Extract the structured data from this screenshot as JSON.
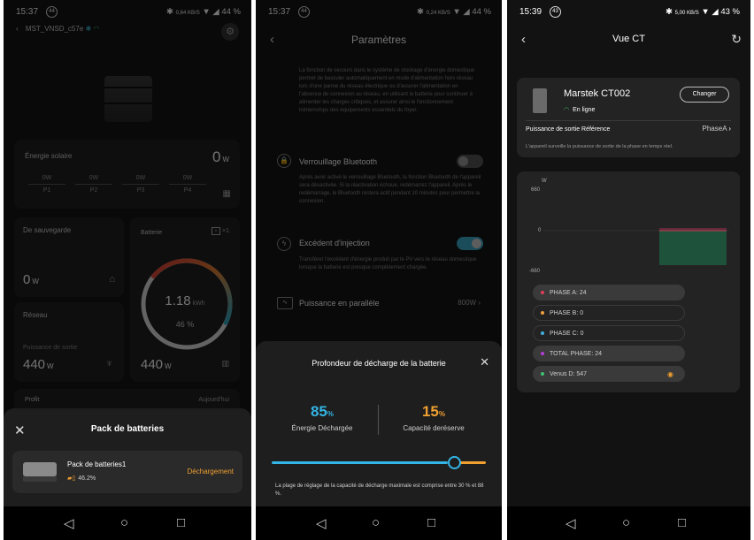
{
  "status_bars": [
    {
      "time": "15:37",
      "notif": "44",
      "net": "0,64 KB/S",
      "battery": "44 %"
    },
    {
      "time": "15:37",
      "notif": "44",
      "net": "0,24 KB/S",
      "battery": "44 %"
    },
    {
      "time": "15:39",
      "notif": "43",
      "net": "5,00 KB/S",
      "battery": "43 %"
    }
  ],
  "screen1": {
    "device_name": "MST_VNSD_c57e",
    "solar": {
      "label": "Énergie solaire",
      "value": "0",
      "unit": "W",
      "panels": [
        {
          "w": "0W",
          "name": "P1"
        },
        {
          "w": "0W",
          "name": "P2"
        },
        {
          "w": "0W",
          "name": "P3"
        },
        {
          "w": "0W",
          "name": "P4"
        }
      ]
    },
    "backup": {
      "label": "De sauvegarde",
      "value": "0",
      "unit": "W"
    },
    "battery": {
      "label": "Batterie",
      "count": "×1",
      "kwh": "1.18",
      "kwh_unit": "kWh",
      "percent": "46 %",
      "power": "440",
      "unit": "W",
      "fill": 0.46
    },
    "grid": {
      "label": "Réseau",
      "sub": "Puissance de sortie",
      "value": "440",
      "unit": "W"
    },
    "profit": {
      "label": "Profit",
      "period": "Aujourd'hui"
    },
    "sheet": {
      "title": "Pack de batteries",
      "item_name": "Pack de batteries1",
      "item_pct": "46.2%",
      "item_status": "Déchargement"
    }
  },
  "screen2": {
    "title": "Paramètres",
    "intro": "La fonction de secours dans le système de stockage d'énergie domestique permet de basculer automatiquement en mode d'alimentation hors réseau lors d'une panne du réseau électrique ou d'assurer l'alimentation en l'absence de connexion au réseau, en utilisant la batterie pour continuer à alimenter les charges critiques, et assurer ainsi le fonctionnement ininterrompu des équipements essentiels du foyer.",
    "bt": {
      "label": "Verrouillage Bluetooth",
      "desc": "Après avoir activé le verrouillage Bluetooth, la fonction Bluetooth de l'appareil sera désactivée. Si la réactivation échoue, redémarrez l'appareil. Après le redémarrage, le Bluetooth restera actif pendant 10 minutes pour permettre la connexion."
    },
    "inj": {
      "label": "Excédent d'injection",
      "desc": "Transférer l'excédent d'énergie produit par le PV vers le réseau domestique lorsque la batterie est presque complètement chargée."
    },
    "parallel": {
      "label": "Puissance en parallèle",
      "value": "800W"
    },
    "dialog": {
      "title": "Profondeur de décharge de la batterie",
      "left_value": "85",
      "left_label": "Énergie Déchargée",
      "right_value": "15",
      "right_label": "Capacité deréserve",
      "percent_sign": "%",
      "slider_fraction": 0.85,
      "note": "La plage de réglage de la capacité de décharge maximale est comprise entre 30 % et 88 %."
    }
  },
  "screen3": {
    "title": "Vue CT",
    "device": {
      "name": "Marstek CT002",
      "status": "En ligne",
      "change": "Changer"
    },
    "ref": {
      "label": "Puissance de sortie Référence",
      "value": "PhaseA"
    },
    "note": "L'appareil surveille la puissance de sortie de la phase en temps réel.",
    "chart": {
      "unit": "W",
      "ticks": [
        "660",
        "0",
        "-660"
      ]
    },
    "phases": [
      {
        "label": "PHASE A: 24",
        "color": "#e0405a",
        "active": true
      },
      {
        "label": "PHASE B: 0",
        "color": "#f0a040",
        "active": false
      },
      {
        "label": "PHASE C: 0",
        "color": "#3fb0e0",
        "active": false
      },
      {
        "label": "TOTAL PHASE: 24",
        "color": "#b040d0",
        "active": true
      },
      {
        "label": "Venus D: 547",
        "color": "#40c070",
        "active": true
      }
    ]
  },
  "colors": {
    "accent_orange": "#f0a030",
    "accent_blue": "#33b5e5",
    "toggle_on": "#3aa8c8",
    "online_green": "#3ec46d"
  }
}
